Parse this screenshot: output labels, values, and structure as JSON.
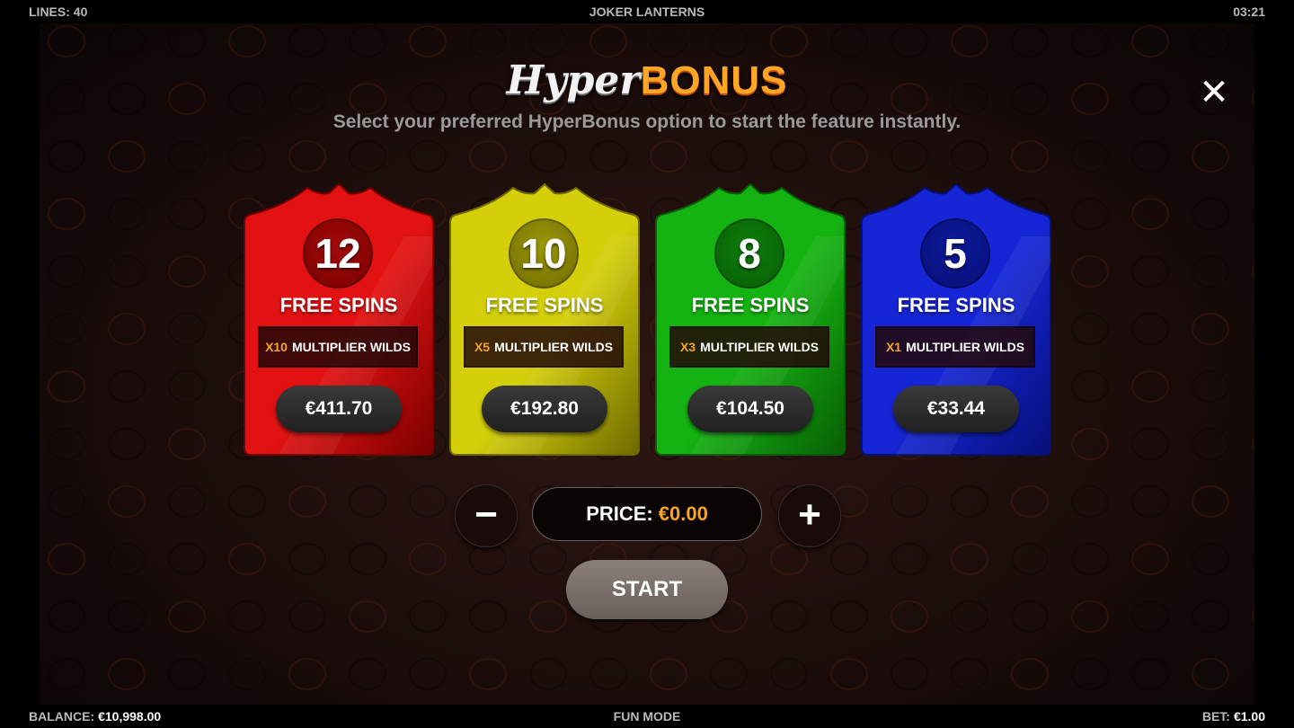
{
  "top_bar": {
    "lines_label": "LINES: 40",
    "game_title": "JOKER LANTERNS",
    "clock": "03:21"
  },
  "bottom_bar": {
    "balance_label": "BALANCE:",
    "balance_value": "€10,998.00",
    "mode": "FUN MODE",
    "bet_label": "BET:",
    "bet_value": "€1.00"
  },
  "header": {
    "logo_hyper": "Hyper",
    "logo_bonus": "BONUS",
    "subtitle": "Select your preferred HyperBonus option to start the feature instantly.",
    "close_glyph": "✕"
  },
  "options": [
    {
      "spins": "12",
      "spins_label": "FREE SPINS",
      "multiplier": "X10",
      "wilds_label": "MULTIPLIER WILDS",
      "price": "€411.70",
      "color": "#e31212",
      "dark": "#7a0000",
      "circle": "#a20a0a"
    },
    {
      "spins": "10",
      "spins_label": "FREE SPINS",
      "multiplier": "X5",
      "wilds_label": "MULTIPLIER WILDS",
      "price": "€192.80",
      "color": "#d4cf0a",
      "dark": "#6f6a00",
      "circle": "#9c980a"
    },
    {
      "spins": "8",
      "spins_label": "FREE SPINS",
      "multiplier": "X3",
      "wilds_label": "MULTIPLIER WILDS",
      "price": "€104.50",
      "color": "#15b312",
      "dark": "#085e05",
      "circle": "#0d7c0b"
    },
    {
      "spins": "5",
      "spins_label": "FREE SPINS",
      "multiplier": "X1",
      "wilds_label": "MULTIPLIER WILDS",
      "price": "€33.44",
      "color": "#1626d6",
      "dark": "#070f78",
      "circle": "#0d1a9a"
    }
  ],
  "controls": {
    "minus": "−",
    "plus": "+",
    "price_label": "PRICE:",
    "price_value": "€0.00",
    "start_label": "START"
  }
}
